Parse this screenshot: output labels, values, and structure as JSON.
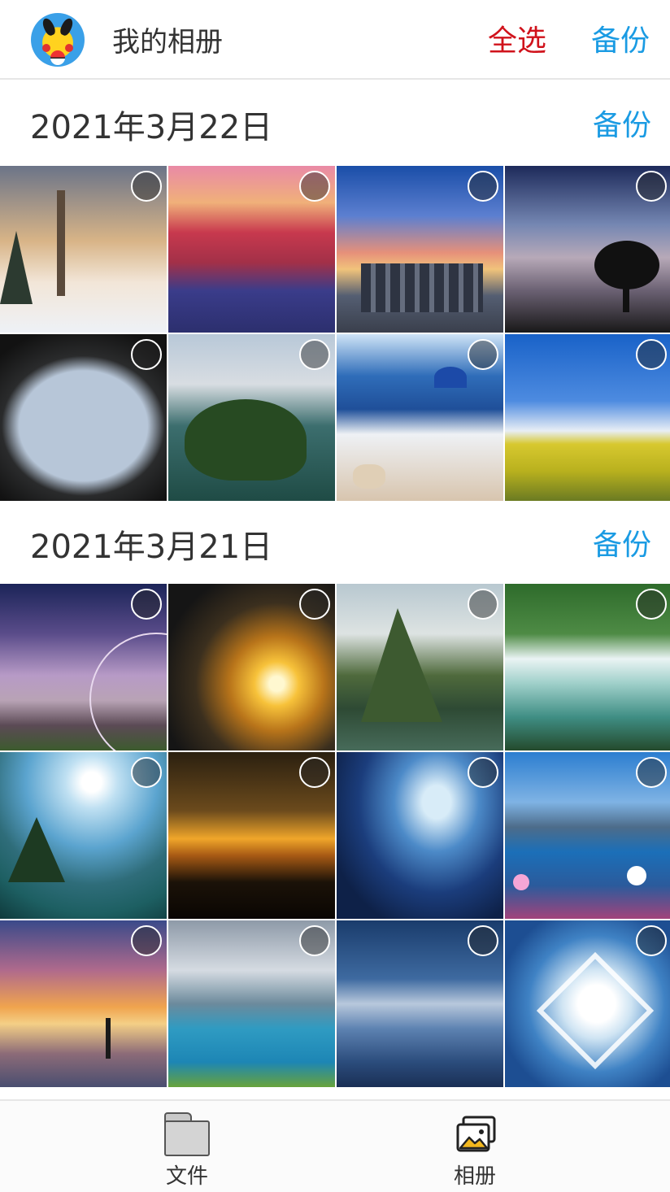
{
  "header": {
    "title": "我的相册",
    "select_all": "全选",
    "backup": "备份",
    "colors": {
      "select_all": "#d0121b",
      "backup": "#1a9be3"
    }
  },
  "sections": [
    {
      "date": "2021年3月22日",
      "backup": "备份",
      "photos": [
        {
          "subject": "winter-sunset-trees"
        },
        {
          "subject": "red-canyon-flowers"
        },
        {
          "subject": "city-skyline-sunset"
        },
        {
          "subject": "lone-tree-silhouette"
        },
        {
          "subject": "heart-cave-mountains"
        },
        {
          "subject": "green-island-sea"
        },
        {
          "subject": "santorini-terrace"
        },
        {
          "subject": "rapeseed-field-blue-sky"
        }
      ]
    },
    {
      "date": "2021年3月21日",
      "backup": "备份",
      "photos": [
        {
          "subject": "fantasy-planet-cabin"
        },
        {
          "subject": "golden-sunburst-clouds"
        },
        {
          "subject": "pitons-mountain-bay"
        },
        {
          "subject": "waterfall-green-river"
        },
        {
          "subject": "lake-island-sunlight"
        },
        {
          "subject": "sunset-grass-silhouette"
        },
        {
          "subject": "blue-fantasy-mountain"
        },
        {
          "subject": "lake-cosmos-flowers"
        },
        {
          "subject": "fisherman-sunset-beach"
        },
        {
          "subject": "turquoise-lake-mountains"
        },
        {
          "subject": "blue-desert-dunes"
        },
        {
          "subject": "snowflake-closeup"
        }
      ]
    }
  ],
  "tabbar": {
    "files": "文件",
    "album": "相册"
  }
}
